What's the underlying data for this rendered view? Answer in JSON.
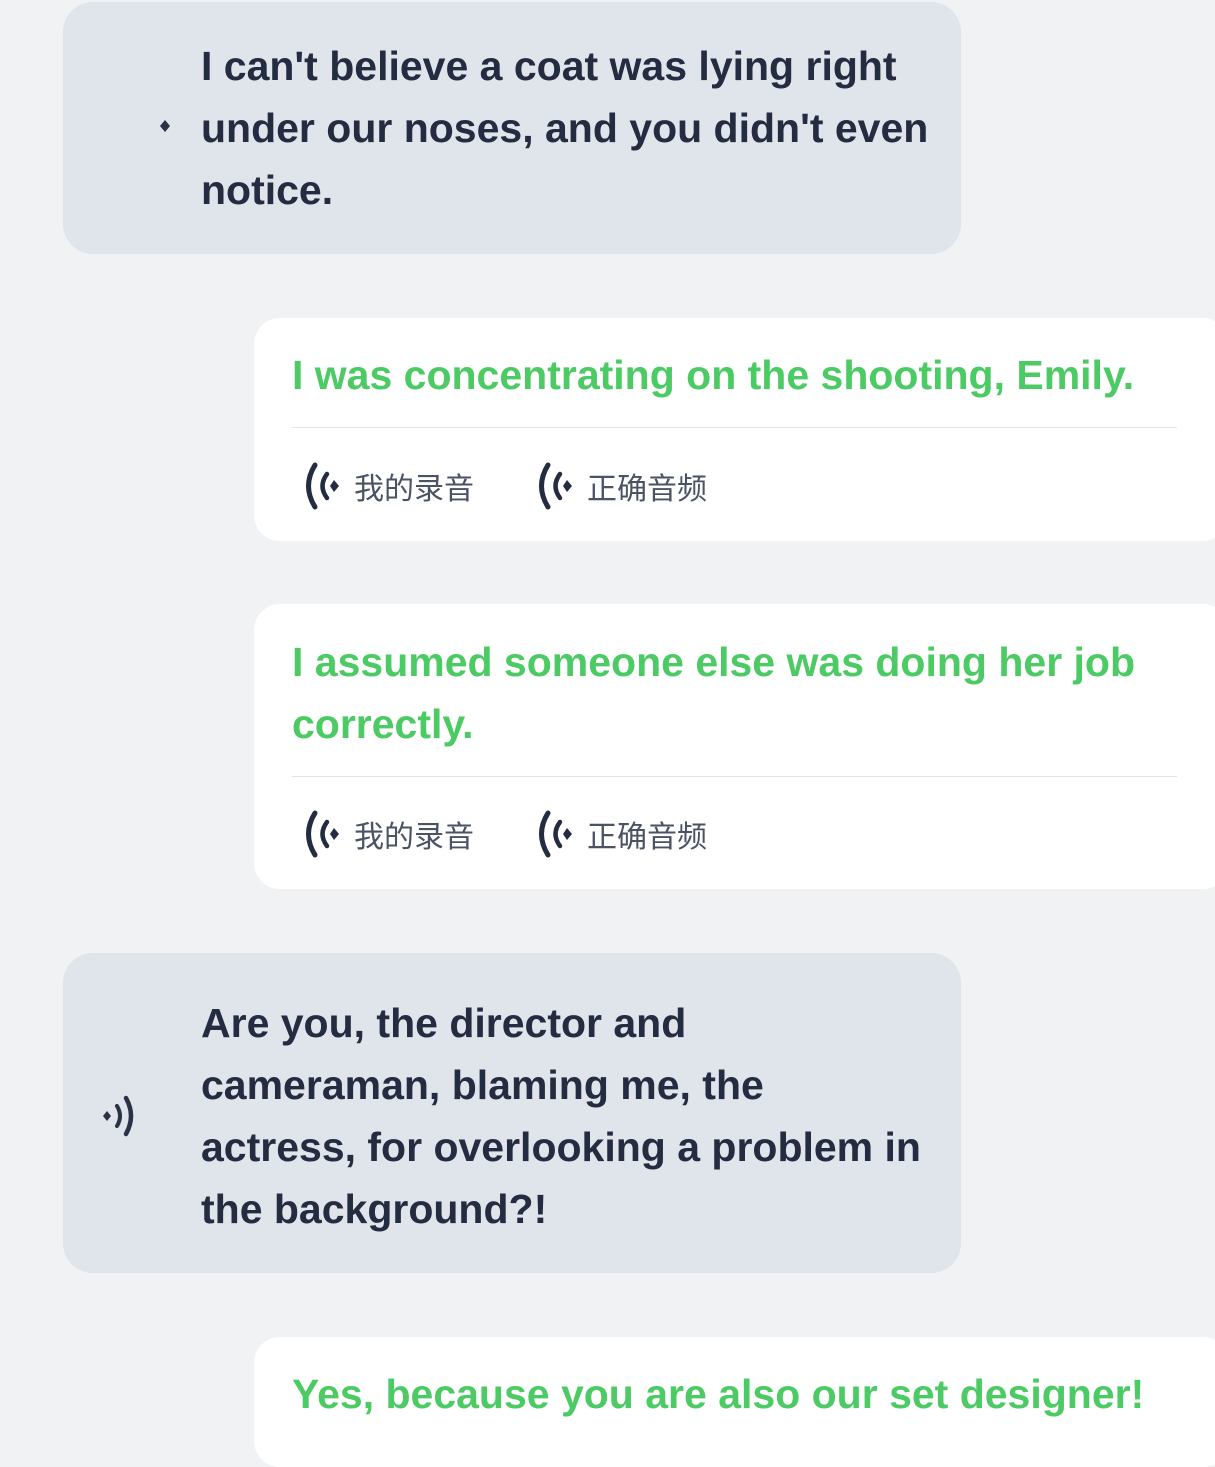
{
  "messages": [
    {
      "type": "partner",
      "speaker_icon": "speaker-icon",
      "text": "I can't believe a coat was lying right under our noses, and you didn't even notice."
    },
    {
      "type": "user",
      "sentence": "I was concentrating on the shooting, Emily.",
      "my_recording_label": "我的录音",
      "correct_audio_label": "正确音频",
      "audio_icon": "audio-wave-icon"
    },
    {
      "type": "user",
      "sentence": "I assumed someone else was doing her job correctly.",
      "my_recording_label": "我的录音",
      "correct_audio_label": "正确音频",
      "audio_icon": "audio-wave-icon"
    },
    {
      "type": "partner",
      "speaker_icon": "speaker-playing-icon",
      "text": "Are you, the director and cameraman, blaming me, the actress, for overlooking a problem in the background?!"
    },
    {
      "type": "user",
      "sentence": "Yes, because you are also our set designer!"
    }
  ],
  "colors": {
    "background": "#f1f2f4",
    "partner_bubble": "#e0e4eb",
    "partner_text": "#232c40",
    "user_card": "#ffffff",
    "user_sentence_green": "#4cca64",
    "audio_label": "#4a5264",
    "divider": "#e3e5e9"
  }
}
